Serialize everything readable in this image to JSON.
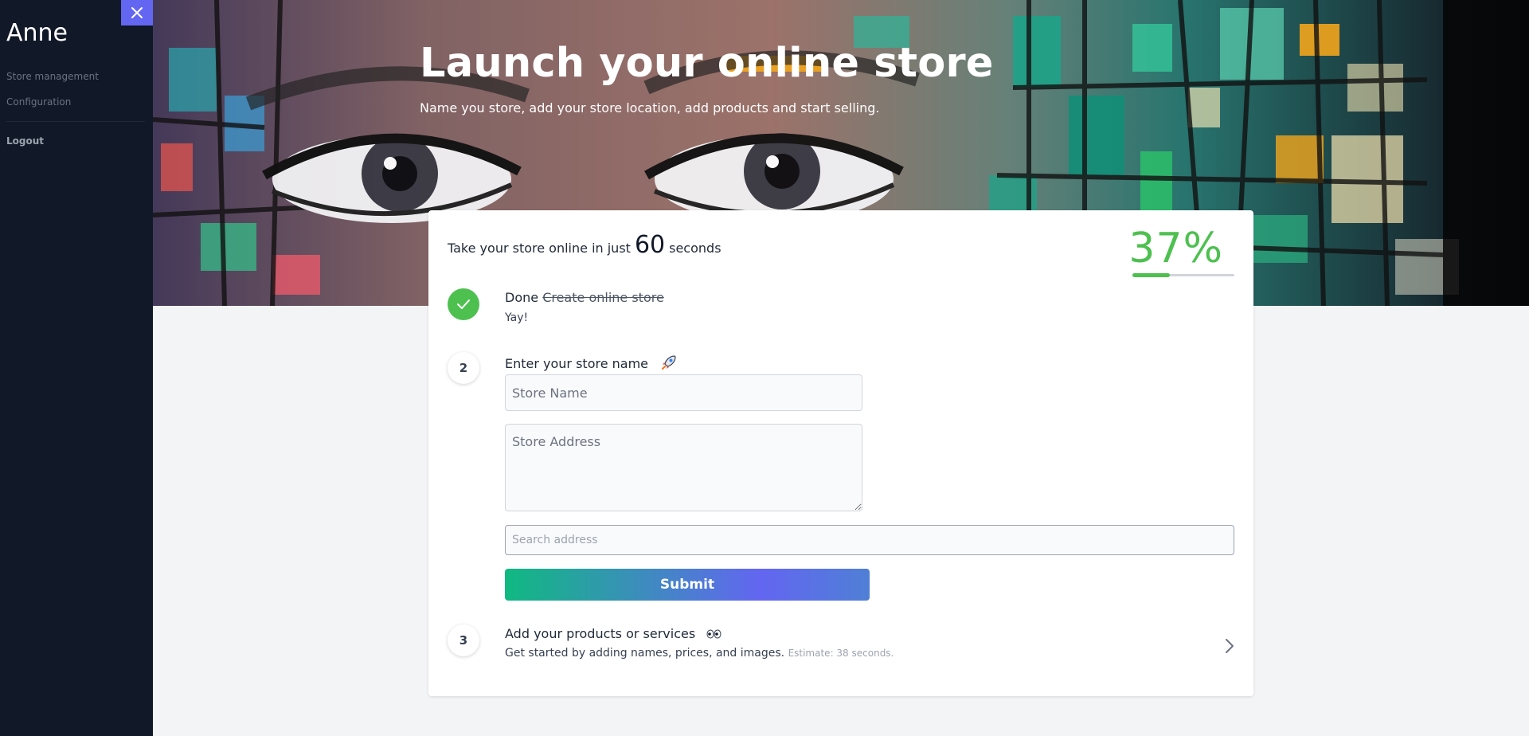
{
  "sidebar": {
    "brand": "Anne",
    "items": [
      {
        "label": "Store management"
      },
      {
        "label": "Configuration"
      }
    ],
    "logout_label": "Logout"
  },
  "hero": {
    "title": "Launch your online store",
    "subtitle": "Name you store, add your store location, add products and start selling."
  },
  "card": {
    "intro_prefix": "Take your store online in just",
    "intro_number": "60",
    "intro_suffix": "seconds",
    "progress_label": "37%",
    "progress_value": 0.37,
    "steps": [
      {
        "status_label": "Done",
        "title": "Create online store",
        "subtitle": "Yay!",
        "icon": "check-icon"
      },
      {
        "number": "2",
        "title": "Enter your store name",
        "icon": "rocket-icon"
      },
      {
        "number": "3",
        "title": "Add your products or services",
        "icon": "eyes-icon",
        "description": "Get started by adding names, prices, and images.",
        "estimate": "Estimate: 38 seconds."
      }
    ],
    "form": {
      "store_name_placeholder": "Store Name",
      "store_address_placeholder": "Store Address",
      "search_placeholder": "Search address",
      "submit_label": "Submit"
    }
  },
  "colors": {
    "sidebar_bg": "#111827",
    "accent": "#6366f1",
    "success": "#4ec050",
    "gradient_start": "#10b981"
  }
}
